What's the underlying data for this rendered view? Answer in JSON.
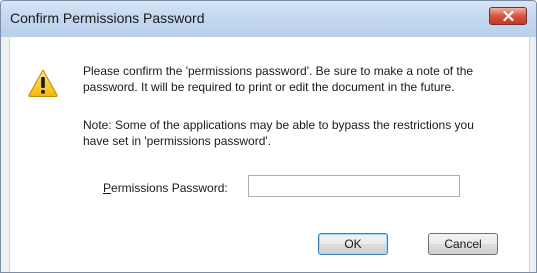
{
  "dialog": {
    "title": "Confirm Permissions Password",
    "close_icon": "close-icon",
    "warning_icon": "warning-icon",
    "message_line1": "Please confirm the 'permissions password'. Be sure to make a note of the",
    "message_line2": "password. It will be required to print or edit the document in the future.",
    "note_line1": "Note: Some of the applications may be able to bypass the restrictions you",
    "note_line2": "have set in 'permissions password'.",
    "password_label_accel": "P",
    "password_label_rest": "ermissions Password:",
    "password_value": "",
    "ok_label": "OK",
    "cancel_label": "Cancel"
  },
  "colors": {
    "titlebar": "#c4d8ef",
    "close_button": "#d8543d",
    "warning_fill": "#f5c518",
    "default_button_border": "#3c7fb1"
  }
}
